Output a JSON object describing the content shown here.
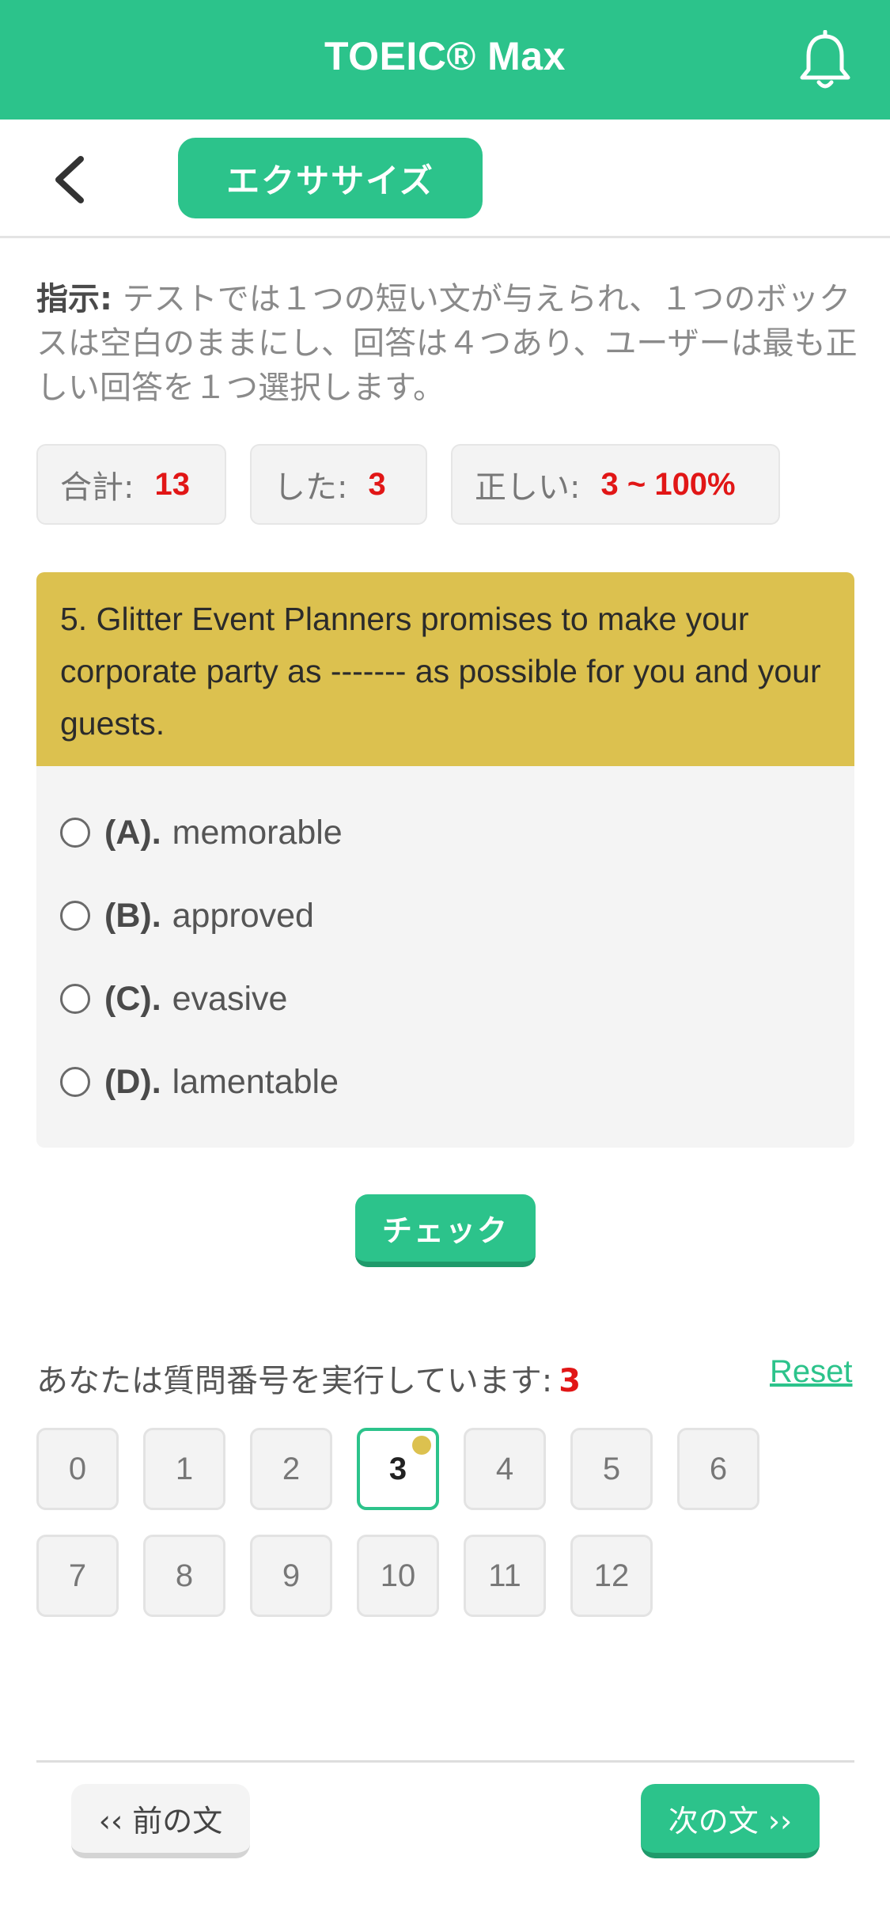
{
  "header": {
    "title": "TOEIC® Max",
    "notification_icon": "bell-icon"
  },
  "nav": {
    "back_icon": "chevron-left-icon",
    "tab_label": "エクササイズ"
  },
  "instructions": {
    "label": "指示:",
    "text": " テストでは１つの短い文が与えられ、１つのボックスは空白のままにし、回答は４つあり、ユーザーは最も正しい回答を１つ選択します。"
  },
  "stats": {
    "total_label": "合計:",
    "total_value": "13",
    "done_label": "した:",
    "done_value": "3",
    "correct_label": "正しい:",
    "correct_value": "3 ~ 100%"
  },
  "question": {
    "text": "5. Glitter Event Planners promises to make your corporate party as ------- as possible for you and your guests.",
    "options": [
      {
        "letter": "(A).",
        "text": "memorable"
      },
      {
        "letter": "(B).",
        "text": "approved"
      },
      {
        "letter": "(C).",
        "text": "evasive"
      },
      {
        "letter": "(D).",
        "text": "lamentable"
      }
    ]
  },
  "check_button": "チェック",
  "progress": {
    "label": "あなたは質問番号を実行しています:",
    "current": "3",
    "reset_label": "Reset"
  },
  "question_numbers": [
    "0",
    "1",
    "2",
    "3",
    "4",
    "5",
    "6",
    "7",
    "8",
    "9",
    "10",
    "11",
    "12"
  ],
  "active_question": "3",
  "footer": {
    "prev_label": "‹‹ 前の文",
    "next_label": "次の文 ››"
  },
  "colors": {
    "primary": "#2cc38b",
    "question_header": "#dcc14f",
    "accent_red": "#e11616"
  }
}
